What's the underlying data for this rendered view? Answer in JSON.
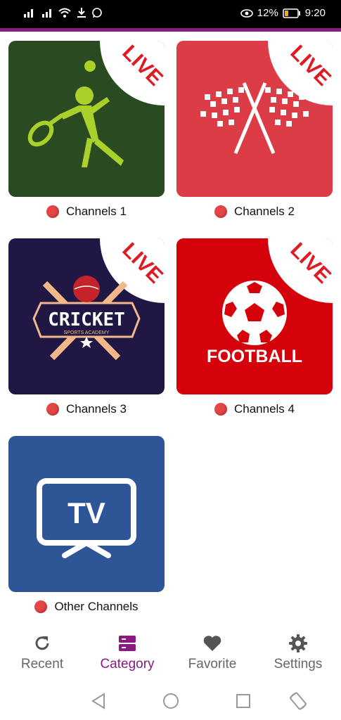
{
  "status_bar": {
    "battery_percent": "12%",
    "time": "9:20"
  },
  "colors": {
    "accent": "#8b1a7e",
    "dot": "#e64545"
  },
  "channels": [
    {
      "label": "Channels 1",
      "badge": "LIVE",
      "tile_color": "#2a4a22",
      "icon": "tennis-player-icon"
    },
    {
      "label": "Channels 2",
      "badge": "LIVE",
      "tile_color": "#dc3c45",
      "icon": "checkered-flags-icon"
    },
    {
      "label": "Channels 3",
      "badge": "LIVE",
      "tile_color": "#201744",
      "icon": "cricket-logo",
      "logo_title": "CRICKET",
      "logo_subtitle": "SPORTS ACADEMY"
    },
    {
      "label": "Channels 4",
      "badge": "LIVE",
      "tile_color": "#d5020b",
      "icon": "football-icon",
      "logo_title": "FOOTBALL"
    },
    {
      "label": "Other Channels",
      "tile_color": "#2e5596",
      "icon": "tv-icon",
      "logo_title": "TV"
    }
  ],
  "bottom_nav": [
    {
      "label": "Recent",
      "icon": "refresh-icon",
      "active": false
    },
    {
      "label": "Category",
      "icon": "category-icon",
      "active": true
    },
    {
      "label": "Favorite",
      "icon": "heart-icon",
      "active": false
    },
    {
      "label": "Settings",
      "icon": "gear-icon",
      "active": false
    }
  ]
}
